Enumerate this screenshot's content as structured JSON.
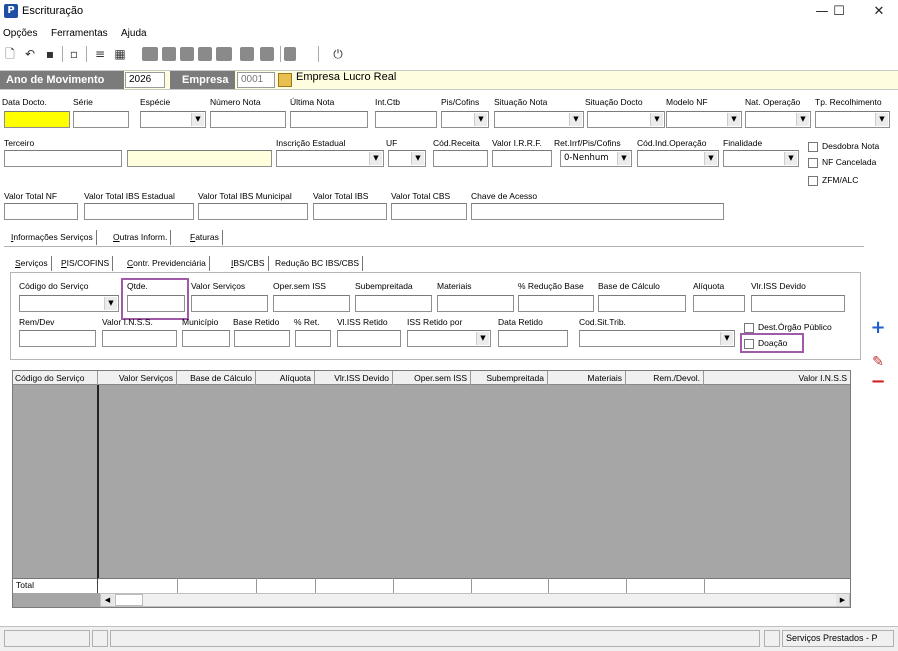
{
  "window": {
    "title": "Escrituração",
    "app_icon": "P",
    "minimize": "—",
    "maximize": "☐",
    "close": "✕"
  },
  "menu": [
    "Opções",
    "Ferramentas",
    "Ajuda"
  ],
  "header": {
    "ano_label": "Ano de Movimento",
    "ano_value": "2026",
    "empresa_label": "Empresa",
    "empresa_code": "0001",
    "empresa_name": "Empresa Lucro Real"
  },
  "row1_labels": {
    "data_docto": "Data Docto.",
    "serie": "Série",
    "especie": "Espécie",
    "numero_nota": "Número Nota",
    "ultima_nota": "Última Nota",
    "int_ctb": "Int.Ctb",
    "pis_cofins": "Pis/Cofins",
    "situacao_nota": "Situação Nota",
    "situacao_docto": "Situação Docto",
    "modelo_nf": "Modelo NF",
    "nat_operacao": "Nat. Operação",
    "tp_recolhimento": "Tp. Recolhimento"
  },
  "row2_labels": {
    "terceiro": "Terceiro",
    "inscricao_estadual": "Inscrição Estadual",
    "uf": "UF",
    "cod_receita": "Cód.Receita",
    "valor_irrf": "Valor I.R.R.F.",
    "ret_irrf": "Ret.Irrf/Pis/Cofins",
    "cod_ind_operacao": "Cód.Ind.Operação",
    "finalidade": "Finalidade"
  },
  "ret_irrf_value": "0-Nenhum",
  "checkboxes": {
    "desdobra_nota": "Desdobra Nota",
    "nf_cancelada": "NF Cancelada",
    "zfm_alc": "ZFM/ALC"
  },
  "row3_labels": {
    "valor_total_nf": "Valor Total NF",
    "valor_total_ibs_estadual": "Valor Total IBS Estadual",
    "valor_total_ibs_municipal": "Valor Total IBS Municipal",
    "valor_total_ibs": "Valor Total IBS",
    "valor_total_cbs": "Valor Total CBS",
    "chave_acesso": "Chave de Acesso"
  },
  "tabs_main": [
    {
      "u": "I",
      "rest": "nformações Serviços"
    },
    {
      "u": "O",
      "rest": "utras Inform."
    },
    {
      "u": "F",
      "rest": "aturas"
    }
  ],
  "tabs_sub": [
    {
      "u": "S",
      "rest": "erviços"
    },
    {
      "u": "P",
      "rest": "IS/COFINS"
    },
    {
      "u": "C",
      "rest": "ontr. Previdenciária"
    },
    {
      "u": "I",
      "rest": "BS/CBS"
    },
    {
      "u": "",
      "rest": "Redução BC IBS/CBS"
    }
  ],
  "serv_labels1": {
    "cod_servico": "Código do Serviço",
    "qtde": "Qtde.",
    "valor_servicos": "Valor Serviços",
    "oper_sem_iss": "Oper.sem ISS",
    "subempreitada": "Subempreitada",
    "materiais": "Materiais",
    "pct_reducao_base": "% Redução Base",
    "base_calculo": "Base de Cálculo",
    "aliquota": "Alíquota",
    "vlr_iss_devido": "Vlr.ISS Devido"
  },
  "serv_labels2": {
    "rem_dev": "Rem/Dev",
    "valor_inss": "Valor I.N.S.S.",
    "municipio": "Município",
    "base_retido": "Base Retido",
    "pct_ret": "% Ret.",
    "vl_iss_retido": "Vl.ISS Retido",
    "iss_retido_por": "ISS Retido por",
    "data_retido": "Data Retido",
    "cod_sit_trib": "Cod.Sit.Trib."
  },
  "serv_checks": {
    "dest_orgao_publico": "Dest.Órgão Público",
    "doacao": "Doação"
  },
  "grid_columns": [
    "Código do Serviço",
    "Valor Serviços",
    "Base de Cálculo",
    "Alíquota",
    "Vlr.ISS Devido",
    "Oper.sem ISS",
    "Subempreitada",
    "Materiais",
    "Rem./Devol.",
    "Valor I.N.S.S"
  ],
  "grid_total_label": "Total",
  "status": {
    "right": "Serviços Prestados - P"
  },
  "colors": {
    "header_bg": "#7b7b7b",
    "yellow_field": "#ffff00",
    "highlight": "#a05aa8",
    "grid_bg": "#a6a6a6"
  }
}
